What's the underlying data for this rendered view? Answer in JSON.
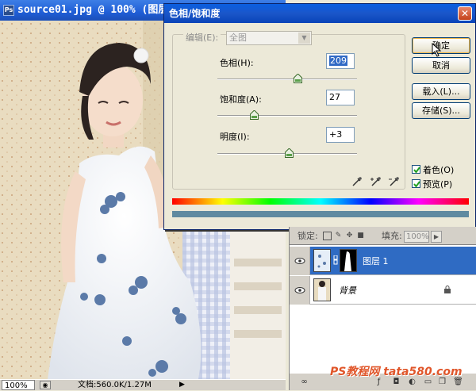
{
  "document": {
    "title": "source01.jpg @ 100% (图层",
    "zoom": "100%",
    "doc_size": "文档:560.0K/1.27M"
  },
  "dialog": {
    "title": "色相/饱和度",
    "edit_label": "编辑(E):",
    "edit_value": "全图",
    "sliders": [
      {
        "label": "色相(H):",
        "value": "209",
        "level": 0.58
      },
      {
        "label": "饱和度(A):",
        "value": "27",
        "level": 0.27
      },
      {
        "label": "明度(I):",
        "value": "+3",
        "level": 0.51
      }
    ],
    "buttons": {
      "ok": "确定",
      "cancel": "取消",
      "load": "载入(L)...",
      "save": "存储(S)..."
    },
    "colorize": {
      "label": "着色(O)",
      "checked": true
    },
    "preview": {
      "label": "预览(P)",
      "checked": true
    },
    "colors": {
      "hue_bottom": "#5f8aa0"
    }
  },
  "layers": {
    "lock_label": "锁定:",
    "fill_label": "填充:",
    "fill_value": "100%",
    "rows": [
      {
        "name": "图层 1",
        "selected": true
      },
      {
        "name": "背景",
        "selected": false,
        "italic": true
      }
    ]
  },
  "watermark": "PS教程网 tata580.com"
}
